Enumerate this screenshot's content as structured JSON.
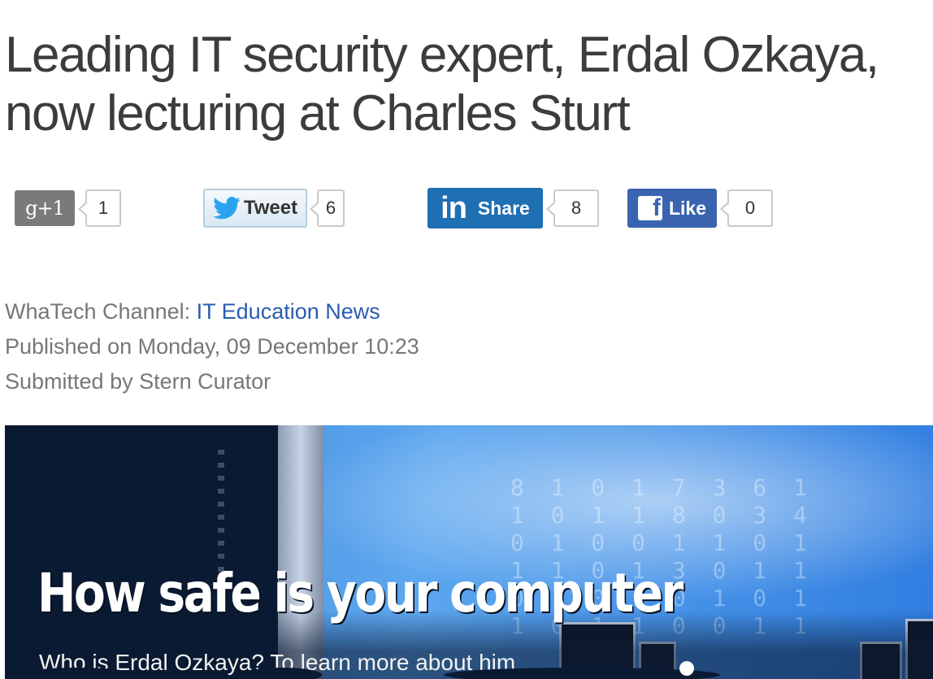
{
  "article": {
    "title": "Leading IT security expert, Erdal Ozkaya, now lecturing at Charles Sturt"
  },
  "share_bar": {
    "google_plus": {
      "label": "g+1",
      "count": "1"
    },
    "twitter": {
      "label": "Tweet",
      "count": "6"
    },
    "linkedin": {
      "logo": "in",
      "label": "Share",
      "count": "8"
    },
    "facebook": {
      "logo": "f",
      "label": "Like",
      "count": "0"
    }
  },
  "meta": {
    "channel_label": "WhaTech Channel: ",
    "channel_link": "IT Education News",
    "published": "Published on Monday, 09 December 10:23",
    "submitted": "Submitted by Stern Curator"
  },
  "hero": {
    "title": "How safe is your computer",
    "subtitle": "Who is Erdal Ozkaya? To learn more about him"
  },
  "icons": [
    "google-plus-icon",
    "twitter-bird-icon",
    "linkedin-icon",
    "facebook-icon"
  ],
  "colors": {
    "linkedin": "#1f6fb3",
    "facebook": "#3b64b0",
    "gplus": "#7a7a7a",
    "link": "#2a5db0"
  }
}
